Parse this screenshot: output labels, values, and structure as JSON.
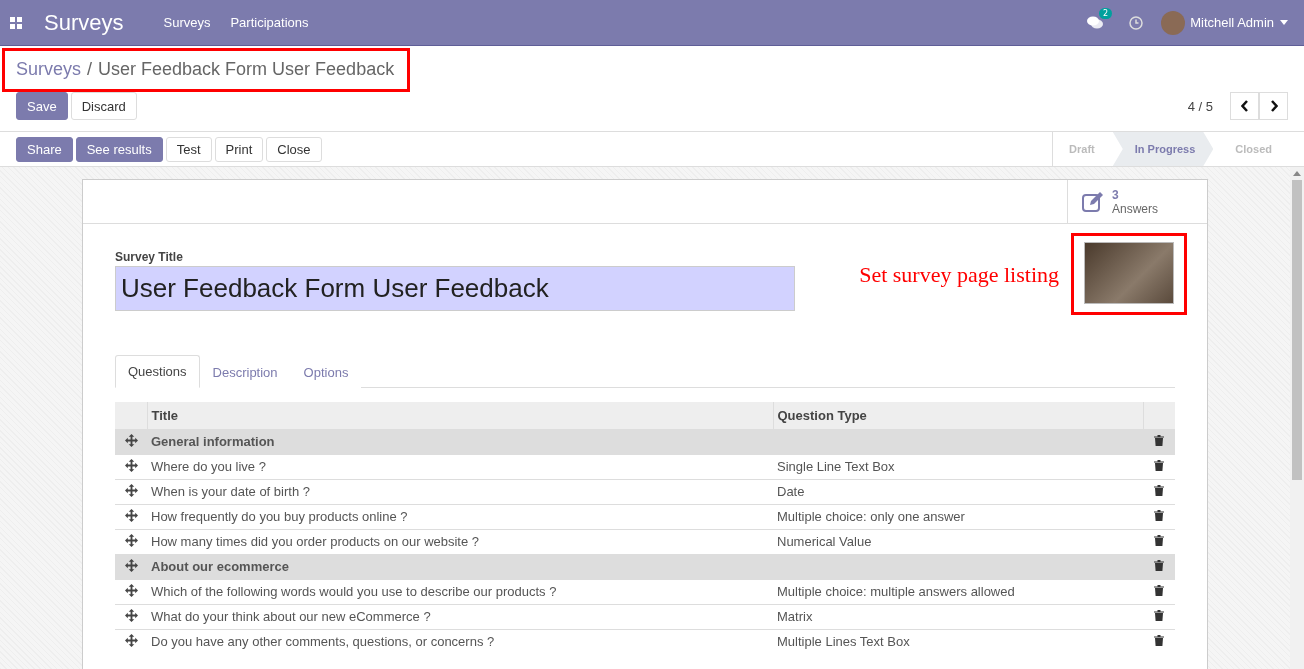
{
  "navbar": {
    "app_title": "Surveys",
    "menus": [
      {
        "label": "Surveys"
      },
      {
        "label": "Participations"
      }
    ],
    "messages_badge": "2",
    "user": "Mitchell Admin"
  },
  "breadcrumb": {
    "parent": "Surveys",
    "separator": "/",
    "current": "User Feedback Form User Feedback"
  },
  "edit_buttons": [
    {
      "label": "Save",
      "kind": "primary"
    },
    {
      "label": "Discard",
      "kind": "secondary"
    }
  ],
  "pager": {
    "text": "4 / 5"
  },
  "action_buttons": [
    {
      "label": "Share",
      "kind": "primary"
    },
    {
      "label": "See results",
      "kind": "primary"
    },
    {
      "label": "Test",
      "kind": "secondary"
    },
    {
      "label": "Print",
      "kind": "secondary"
    },
    {
      "label": "Close",
      "kind": "secondary"
    }
  ],
  "stages": [
    {
      "label": "Draft",
      "selected": false
    },
    {
      "label": "In Progress",
      "selected": true
    },
    {
      "label": "Closed",
      "selected": false
    }
  ],
  "stat_button": {
    "value": "3",
    "label": "Answers"
  },
  "title_field": {
    "label": "Survey Title",
    "value": "User Feedback Form User Feedback"
  },
  "annotation": {
    "text": "Set survey page listing"
  },
  "tabs": [
    {
      "label": "Questions",
      "selected": true
    },
    {
      "label": "Description",
      "selected": false
    },
    {
      "label": "Options",
      "selected": false
    }
  ],
  "table": {
    "columns": [
      "Title",
      "Question Type"
    ],
    "rows": [
      {
        "kind": "section",
        "title": "General information",
        "type": ""
      },
      {
        "kind": "question",
        "title": "Where do you live ?",
        "type": "Single Line Text Box"
      },
      {
        "kind": "question",
        "title": "When is your date of birth ?",
        "type": "Date"
      },
      {
        "kind": "question",
        "title": "How frequently do you buy products online ?",
        "type": "Multiple choice: only one answer"
      },
      {
        "kind": "question",
        "title": "How many times did you order products on our website ?",
        "type": "Numerical Value"
      },
      {
        "kind": "section",
        "title": "About our ecommerce",
        "type": ""
      },
      {
        "kind": "question",
        "title": "Which of the following words would you use to describe our products ?",
        "type": "Multiple choice: multiple answers allowed"
      },
      {
        "kind": "question",
        "title": "What do your think about our new eCommerce ?",
        "type": "Matrix"
      },
      {
        "kind": "question",
        "title": "Do you have any other comments, questions, or concerns ?",
        "type": "Multiple Lines Text Box"
      }
    ]
  }
}
